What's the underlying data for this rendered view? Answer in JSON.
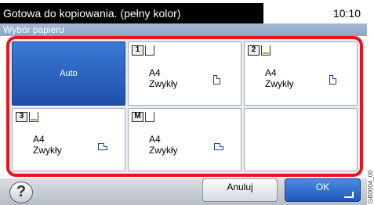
{
  "status": {
    "message": "Gotowa do kopiowania. (pełny kolor)",
    "time": "10:10"
  },
  "screen_title": "Wybór papieru",
  "tiles": [
    {
      "id": "auto",
      "label": "Auto",
      "selected": true
    },
    {
      "id": "drawer-1",
      "drawer": "1",
      "size": "A4",
      "type": "Zwykły",
      "orientation": "portrait",
      "fill_level": 0
    },
    {
      "id": "drawer-2",
      "drawer": "2",
      "size": "A4",
      "type": "Zwykły",
      "orientation": "portrait",
      "fill_level": 0.2
    },
    {
      "id": "drawer-3",
      "drawer": "3",
      "size": "A4",
      "type": "Zwykły",
      "orientation": "landscape",
      "fill_level": 0.2
    },
    {
      "id": "mp-tray",
      "drawer": "M",
      "size": "A4",
      "type": "Zwykły",
      "orientation": "landscape",
      "fill_level": 0
    }
  ],
  "buttons": {
    "help": "?",
    "cancel": "Anuluj",
    "ok": "OK"
  },
  "side_code": "GB0004_00",
  "colors": {
    "selection_border": "#e8141c",
    "selected_tile": "#2a64c0",
    "ok_button": "#2f6fcf"
  }
}
